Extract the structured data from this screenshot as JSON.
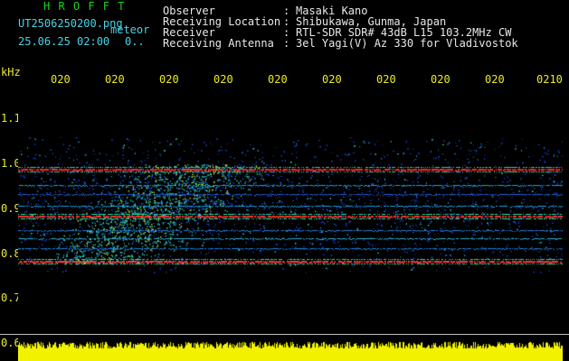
{
  "header": {
    "brand": "H R O F F T",
    "filename": "UT2506250200.png",
    "meteor_label": "meteor",
    "datetime": "25.06.25 02:00",
    "count": "0..",
    "info": [
      {
        "label": "Observer",
        "sep": ":",
        "value": "Masaki Kano"
      },
      {
        "label": "Receiving Location",
        "sep": ":",
        "value": "Shibukawa, Gunma, Japan"
      },
      {
        "label": "Receiver",
        "sep": ":",
        "value": "RTL-SDR SDR# 43dB L15 103.2MHz CW"
      },
      {
        "label": "Receiving Antenna",
        "sep": ":",
        "value": "3el Yagi(V) Az 330 for Vladivostok"
      }
    ]
  },
  "axis": {
    "unit": "kHz",
    "time_ticks": [
      "020",
      "020",
      "020",
      "020",
      "020",
      "020",
      "020",
      "020",
      "020",
      "0210"
    ],
    "freq_ticks": [
      "1.1",
      "1.0",
      "0.9",
      "0.8",
      "0.7",
      "0.6"
    ]
  },
  "colors": {
    "background": "#000000",
    "brand": "#1fd21f",
    "timestamp": "#49d3e6",
    "header_text": "#e8e8e8",
    "ticks": "#eaea2a",
    "signal_hot": "#ff2020",
    "signal_mid": "#30e0a0",
    "signal_low": "#1840c8",
    "baseline": "#f2f200"
  }
}
